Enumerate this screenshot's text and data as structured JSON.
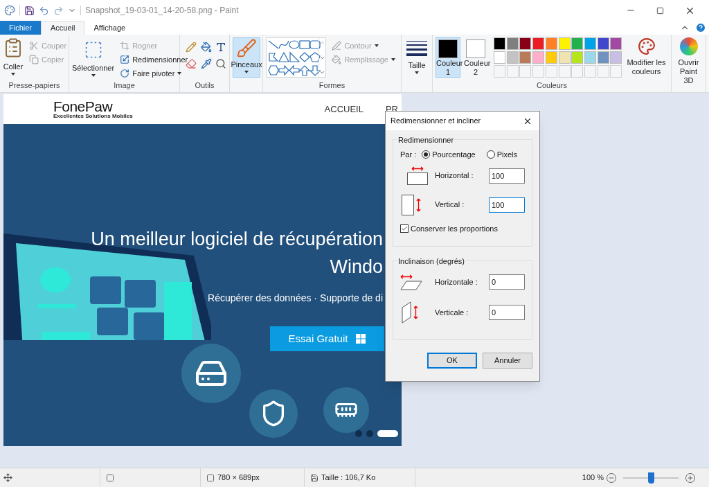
{
  "window": {
    "title": "Snapshot_19-03-01_14-20-58.png - Paint"
  },
  "tabs": [
    {
      "label": "Fichier",
      "kind": "file",
      "selected": false
    },
    {
      "label": "Accueil",
      "kind": "tab",
      "selected": true
    },
    {
      "label": "Affichage",
      "kind": "tab",
      "selected": false
    }
  ],
  "clipboard": {
    "label": "Presse-papiers",
    "paste": "Coller",
    "actions": [
      {
        "label": "Couper",
        "disabled": true
      },
      {
        "label": "Copier",
        "disabled": true
      }
    ]
  },
  "image": {
    "label": "Image",
    "select": "Sélectionner",
    "actions": [
      {
        "label": "Rogner",
        "disabled": true
      },
      {
        "label": "Redimensionner",
        "disabled": false
      },
      {
        "label": "Faire pivoter",
        "disabled": false
      }
    ]
  },
  "tools": {
    "label": "Outils"
  },
  "brushes": {
    "label": "Pinceaux",
    "selected": true
  },
  "shapes": {
    "label": "Formes",
    "actions": [
      {
        "label": "Contour",
        "disabled": true
      },
      {
        "label": "Remplissage",
        "disabled": true
      }
    ]
  },
  "size": {
    "label": "Taille"
  },
  "colors": {
    "label": "Couleurs",
    "slots": [
      {
        "label": "Couleur 1",
        "color": "#000000",
        "selected": true
      },
      {
        "label": "Couleur 2",
        "color": "#ffffff",
        "selected": false
      }
    ],
    "palette": [
      {
        "color": "#000000"
      },
      {
        "color": "#7f7f7f"
      },
      {
        "color": "#880015"
      },
      {
        "color": "#ed1c24"
      },
      {
        "color": "#ff7f27"
      },
      {
        "color": "#fff200"
      },
      {
        "color": "#22b14c"
      },
      {
        "color": "#00a2e8"
      },
      {
        "color": "#3f48cc"
      },
      {
        "color": "#a349a4"
      },
      {
        "color": "#ffffff"
      },
      {
        "color": "#c3c3c3"
      },
      {
        "color": "#b97a57"
      },
      {
        "color": "#ffaec9"
      },
      {
        "color": "#ffc90e"
      },
      {
        "color": "#efe4b0"
      },
      {
        "color": "#b5e61d"
      },
      {
        "color": "#99d9ea"
      },
      {
        "color": "#7092be"
      },
      {
        "color": "#c8bfe7"
      }
    ],
    "edit": "Modifier les couleurs"
  },
  "paint3d": {
    "label": "Ouvrir Paint 3D"
  },
  "canvas_image": {
    "logo": "FonePaw",
    "tagline": "Excellentes Solutions Mobiles",
    "nav": [
      "ACCUEIL",
      "PR"
    ],
    "headline": "Un meilleur logiciel de récupération",
    "headline_2": "Windo",
    "subtitle": "Récupérer des données · Supporte de di",
    "cta": "Essai Gratuit",
    "carousel": [
      {
        "selected": false
      },
      {
        "selected": false
      },
      {
        "selected": true
      }
    ]
  },
  "dialog": {
    "title": "Redimensionner et incliner",
    "resize": {
      "legend": "Redimensionner",
      "by_label": "Par :",
      "units": [
        {
          "label": "Pourcentage",
          "selected": true
        },
        {
          "label": "Pixels",
          "selected": false
        }
      ],
      "fields": [
        {
          "label": "Horizontal :",
          "value": "100",
          "focused": false
        },
        {
          "label": "Vertical :",
          "value": "100",
          "focused": true
        }
      ],
      "keep_ratio": {
        "label": "Conserver les proportions",
        "checked": true
      }
    },
    "skew": {
      "legend": "Inclinaison (degrés)",
      "fields": [
        {
          "label": "Horizontale :",
          "value": "0",
          "focused": false
        },
        {
          "label": "Verticale :",
          "value": "0",
          "focused": false
        }
      ]
    },
    "buttons": [
      {
        "label": "OK",
        "default": true
      },
      {
        "label": "Annuler",
        "default": false
      }
    ]
  },
  "status_bar": {
    "dimensions": "780 × 689px",
    "size": "Taille : 106,7 Ko",
    "zoom": "100 %",
    "zoom_slider": {
      "level": 0.5
    }
  }
}
